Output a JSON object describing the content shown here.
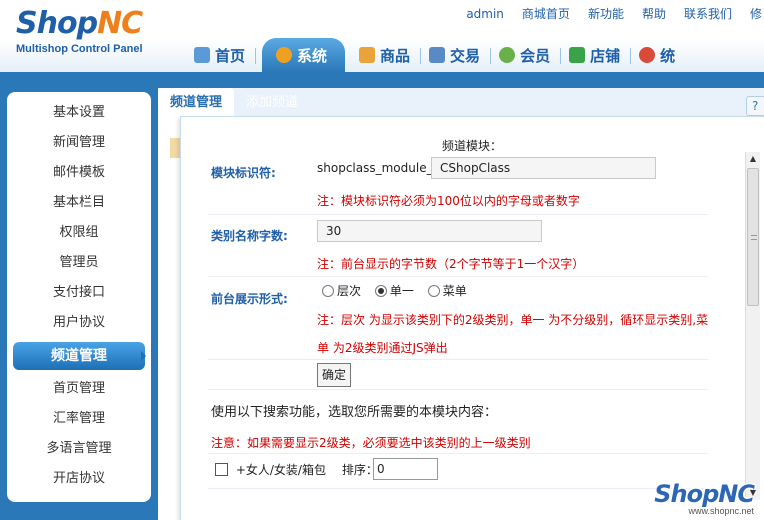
{
  "header": {
    "logo_main": "ShopNC",
    "logo_sub": "Multishop Control Panel",
    "top_links": [
      "admin",
      "商城首页",
      "新功能",
      "帮助",
      "联系我们",
      "修"
    ],
    "nav_tabs": [
      {
        "label": "首页",
        "icon": "home-icon",
        "color": "#5a9ad6"
      },
      {
        "label": "系统",
        "icon": "gear-icon",
        "color": "#f0a020",
        "active": true
      },
      {
        "label": "商品",
        "icon": "box-icon",
        "color": "#e8a43a"
      },
      {
        "label": "交易",
        "icon": "truck-icon",
        "color": "#5a8ac6"
      },
      {
        "label": "会员",
        "icon": "users-icon",
        "color": "#6ab04a"
      },
      {
        "label": "店铺",
        "icon": "shop-icon",
        "color": "#3aa34a"
      },
      {
        "label": "统",
        "icon": "chart-icon",
        "color": "#d94a3a"
      }
    ]
  },
  "sidebar": {
    "items": [
      {
        "label": "基本设置"
      },
      {
        "label": "新闻管理"
      },
      {
        "label": "邮件模板"
      },
      {
        "label": "基本栏目"
      },
      {
        "label": "权限组"
      },
      {
        "label": "管理员"
      },
      {
        "label": "支付接口"
      },
      {
        "label": "用户协议"
      },
      {
        "label": "频道管理",
        "active": true
      },
      {
        "label": "首页管理"
      },
      {
        "label": "汇率管理"
      },
      {
        "label": "多语言管理"
      },
      {
        "label": "开店协议"
      }
    ]
  },
  "content": {
    "tabs": [
      "频道管理",
      "添加频道"
    ],
    "help_label": "? 帮"
  },
  "form": {
    "section_title": "频道模块：",
    "module_id_label": "模块标识符:",
    "module_id_prefix": "shopclass_module_",
    "module_id_value": "CShopClass",
    "module_id_note": "注：模块标识符必须为100位以内的字母或者数字",
    "name_len_label": "类别名称字数:",
    "name_len_value": "30",
    "name_len_note": "注：前台显示的字节数（2个字节等于1一个汉字）",
    "display_label": "前台展示形式:",
    "display_options": [
      "层次",
      "单一",
      "菜单"
    ],
    "display_note_1": "注：层次 为显示该类别下的2级类别，单一 为不分级别，循环显示类别,菜",
    "display_note_2": "单 为2级类别通过JS弹出",
    "confirm_label": "确定",
    "search_intro": "使用以下搜索功能，选取您所需要的本模块内容：",
    "search_note": "注意：如果需要显示2级类，必须要选中该类别的上一级类别",
    "category_label": "+女人/女装/箱包",
    "sort_label": "排序：",
    "sort_value": "0"
  },
  "watermark": {
    "logo": "ShopNC",
    "url": "www.shopnc.net"
  }
}
